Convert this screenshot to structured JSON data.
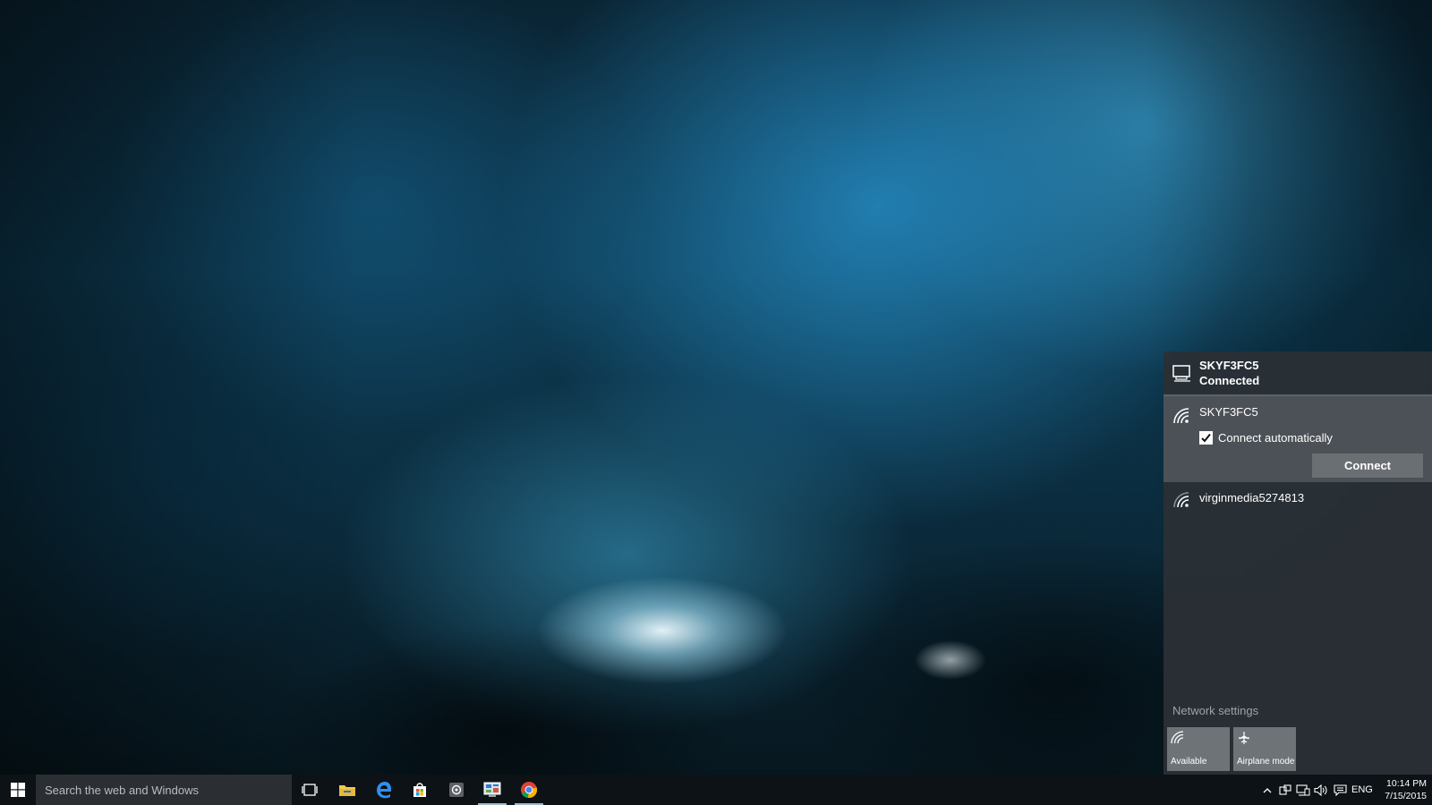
{
  "network_flyout": {
    "current": {
      "name": "SKYF3FC5",
      "status": "Connected",
      "icon": "ethernet-icon"
    },
    "selected_network": {
      "name": "SKYF3FC5",
      "icon": "wifi-signal-icon",
      "connect_automatically_label": "Connect automatically",
      "connect_automatically_checked": true,
      "connect_button": "Connect"
    },
    "other_networks": [
      {
        "name": "virginmedia5274813",
        "icon": "wifi-signal-icon"
      }
    ],
    "network_settings_link": "Network settings",
    "quick_actions": [
      {
        "label": "Available",
        "icon": "wifi-icon"
      },
      {
        "label": "Airplane mode",
        "icon": "airplane-icon"
      }
    ]
  },
  "taskbar": {
    "search_placeholder": "Search the web and Windows",
    "pinned": [
      "task-view",
      "file-explorer",
      "edge",
      "store",
      "media-app",
      "control-panel",
      "chrome"
    ],
    "tray": {
      "language": "ENG",
      "time": "10:14 PM",
      "date": "7/15/2015"
    }
  },
  "colors": {
    "flyout_bg": "#2b3035",
    "selected_item_bg": "#4c5157",
    "button_bg": "#6a6f74",
    "taskbar_bg": "#0d1216",
    "accent_edge": "#1e7fd6"
  }
}
